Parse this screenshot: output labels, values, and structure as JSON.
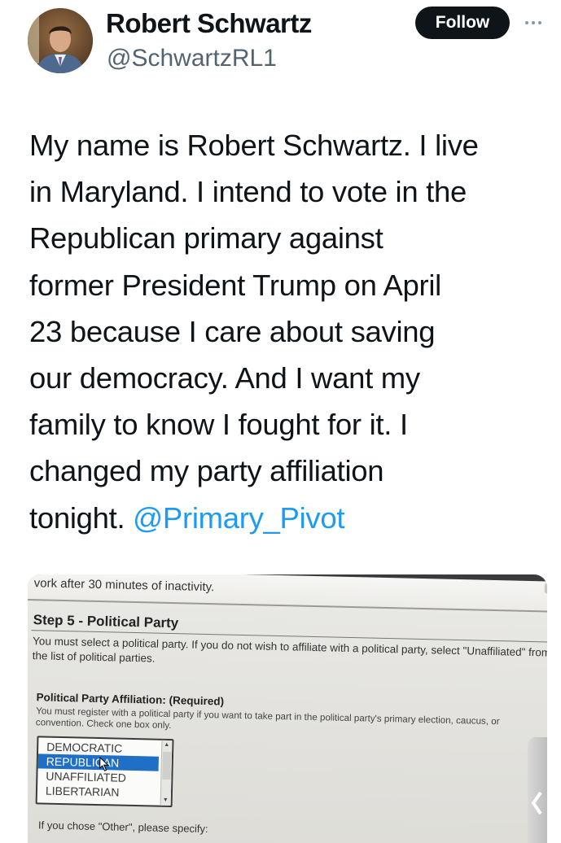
{
  "post": {
    "author_name": "Robert Schwartz",
    "author_handle": "@SchwartzRL1",
    "follow_label": "Follow",
    "text_lines": [
      "My name is Robert Schwartz.  I live",
      "in Maryland. I intend to vote in the",
      "Republican primary against",
      "former President Trump on April",
      "23 because I care about saving",
      "our democracy. And I want my",
      "family to know I fought for it. I",
      "changed my party affiliation"
    ],
    "text_last_prefix": "tonight. ",
    "mention": "@Primary_Pivot"
  },
  "photo": {
    "top_text": "vork after 30 minutes of inactivity.",
    "step_title": "Step 5 - Political Party",
    "step_desc": "You must select a political party. If you do not wish to affiliate with a political party, select \"Unaffiliated\" from the list of political parties.",
    "affiliation_title": "Political Party Affiliation: (Required)",
    "affiliation_desc": "You must register with a political party if you want to take part in the political party's primary election, caucus, or convention. Check one box only.",
    "party_options": [
      "DEMOCRATIC",
      "REPUBLICAN",
      "UNAFFILIATED",
      "LIBERTARIAN"
    ],
    "selected_option": "REPUBLICAN",
    "other_label": "If you chose \"Other\", please specify:"
  },
  "colors": {
    "text": "#0f1419",
    "secondary": "#536471",
    "mention": "#1d9bf0",
    "follow_bg": "#0f1419",
    "listbox_selected": "#1f6fc7"
  },
  "icons": [
    "more-icon",
    "avatar"
  ]
}
